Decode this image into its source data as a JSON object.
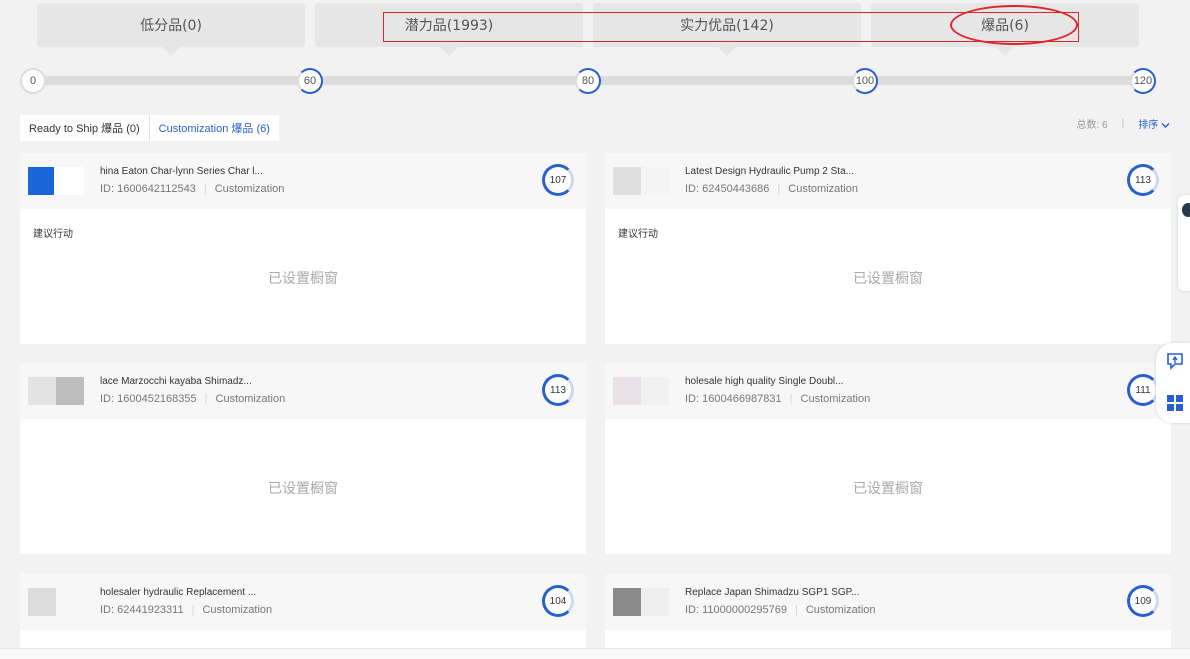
{
  "tiers": [
    {
      "label": "低分品(0)"
    },
    {
      "label": "潜力品(1993)"
    },
    {
      "label": "实力优品(142)"
    },
    {
      "label": "爆品(6)"
    }
  ],
  "slider_ticks": [
    "0",
    "60",
    "80",
    "100",
    "120"
  ],
  "subtabs": {
    "ready_to_ship": "Ready to Ship 爆品 (0)",
    "customization": "Customization 爆品 (6)"
  },
  "meta": {
    "total": "总数: 6",
    "sort": "排序"
  },
  "products": [
    {
      "title": "hina Eaton Char-lynn Series Char l...",
      "id": "ID: 1600642112543",
      "type": "Customization",
      "score": "107",
      "advice": "建议行动",
      "status": "已设置橱窗"
    },
    {
      "title": "Latest Design Hydraulic Pump 2 Sta...",
      "id": "ID: 62450443686",
      "type": "Customization",
      "score": "113",
      "advice": "建议行动",
      "status": "已设置橱窗"
    },
    {
      "title": "lace Marzocchi kayaba Shimadz...",
      "id": "ID: 1600452168355",
      "type": "Customization",
      "score": "113",
      "advice": "",
      "status": "已设置橱窗"
    },
    {
      "title": "holesale high quality Single Doubl...",
      "id": "ID: 1600466987831",
      "type": "Customization",
      "score": "111",
      "advice": "",
      "status": "已设置橱窗"
    },
    {
      "title": "holesaler hydraulic Replacement ...",
      "id": "ID: 62441923311",
      "type": "Customization",
      "score": "104",
      "advice": "",
      "status": ""
    },
    {
      "title": "Replace Japan Shimadzu SGP1 SGP...",
      "id": "ID: 11000000295769",
      "type": "Customization",
      "score": "109",
      "advice": "",
      "status": ""
    }
  ],
  "colors": {
    "accent": "#2a5fcf",
    "annotation": "#d9272a"
  },
  "icons": [
    "feedback-icon",
    "grid-apps-icon",
    "user-avatar"
  ]
}
